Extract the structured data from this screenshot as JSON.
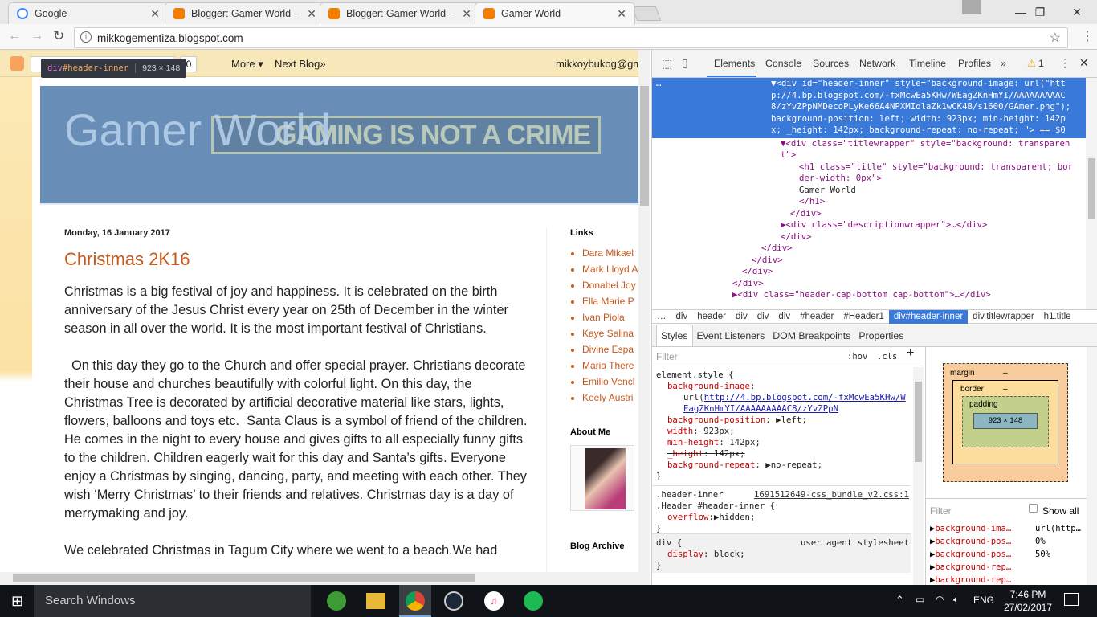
{
  "browser": {
    "tabs": [
      {
        "title": "Google",
        "favicon_color": "#4285f4"
      },
      {
        "title": "Blogger: Gamer World - ",
        "favicon_color": "#f57d00"
      },
      {
        "title": "Blogger: Gamer World - ",
        "favicon_color": "#f57d00"
      },
      {
        "title": "Gamer World",
        "favicon_color": "#f57d00"
      }
    ],
    "url": "mikkogementiza.blogspot.com"
  },
  "blogger_nav": {
    "more": "More ▾",
    "next_blog": "Next Blog»",
    "user": "mikkoybukog@gmail.com",
    "count": "0"
  },
  "tooltip": {
    "selector_tag": "div",
    "selector_id": "#header-inner",
    "size": "923 × 148"
  },
  "blog": {
    "title": "Gamer World",
    "banner_text": "GAMING IS NOT A CRIME",
    "post_date": "Monday, 16 January 2017",
    "post_title": "Christmas 2K16",
    "paragraphs": [
      "Christmas is a big festival of joy and happiness. It is celebrated on the birth anniversary of the Jesus Christ every year on 25th of December in the winter season in all over the world. It is the most important festival of Christians.",
      "  On this day they go to the Church and offer special prayer. Christians decorate their house and churches beautifully with colorful light. On this day, the Christmas Tree is decorated by artificial decorative material like stars, lights, flowers, balloons and toys etc.  Santa Claus is a symbol of friend of the children. He comes in the night to every house and gives gifts to all especially funny gifts to the children. Children eagerly wait for this day and Santa’s gifts. Everyone enjoy a Christmas by singing, dancing, party, and meeting with each other. They wish ‘Merry Christmas’ to their friends and relatives. Christmas day is a day of merrymaking and joy.",
      "We celebrated Christmas in Tagum City where we went to a beach.We had"
    ],
    "sidebar": {
      "links_title": "Links",
      "links": [
        "Dara Mikael",
        "Mark Lloyd A",
        "Donabel Joy",
        "Ella Marie P",
        "Ivan Piola",
        "Kaye Salina",
        "Divine Espa",
        "Maria There",
        "Emilio Vencl",
        "Keely Austri"
      ],
      "about_title": "About Me",
      "archive_title": "Blog Archive"
    }
  },
  "devtools": {
    "tabs": [
      "Elements",
      "Console",
      "Sources",
      "Network",
      "Timeline",
      "Profiles",
      "»"
    ],
    "warnings": "1",
    "dom_lines": [
      {
        "t": "sel",
        "text": "▼<div id=\"header-inner\" style=\"background-image: url(\"http://4.bp.blogspot.com/-fxMcwEa5KHw/WEagZKnHmYI/AAAAAAAAAC8/zYvZPpNMDecoPLyKe66A4NPXMIolaZk1wCK4B/s1600/GAmer.png\"); background-position: left; width: 923px; min-height: 142px; _height: 142px; background-repeat: no-repeat; \"> == $0"
      },
      {
        "t": "l1",
        "text": "▼<div class=\"titlewrapper\" style=\"background: transparent\">"
      },
      {
        "t": "l2",
        "text": "<h1 class=\"title\" style=\"background: transparent; border-width: 0px\">"
      },
      {
        "t": "l3",
        "text": "Gamer World"
      },
      {
        "t": "l2",
        "text": "</h1>"
      },
      {
        "t": "l1b",
        "text": "</div>"
      },
      {
        "t": "l1",
        "text": "▶<div class=\"descriptionwrapper\">…</div>"
      },
      {
        "t": "l0",
        "text": "</div>"
      },
      {
        "t": "m1",
        "text": "</div>"
      },
      {
        "t": "m2",
        "text": "</div>"
      },
      {
        "t": "m3",
        "text": "</div>"
      },
      {
        "t": "m4",
        "text": "</div>"
      },
      {
        "t": "m5",
        "text": "▶<div class=\"header-cap-bottom cap-bottom\">…</div>"
      }
    ],
    "breadcrumb": [
      "…",
      "div",
      "header",
      "div",
      "div",
      "div",
      "#header",
      "#Header1",
      "div#header-inner",
      "div.titlewrapper",
      "h1.title"
    ],
    "subtabs": [
      "Styles",
      "Event Listeners",
      "DOM Breakpoints",
      "Properties"
    ],
    "filter_placeholder": "Filter",
    "hov": ":hov",
    "cls": ".cls",
    "box_model": {
      "margin": "margin",
      "border": "border",
      "padding": "padding",
      "content": "923 × 148",
      "dash": "–"
    },
    "show_all": "Show all",
    "computed": [
      {
        "p": "background-ima…",
        "v": "url(http…"
      },
      {
        "p": "background-pos…",
        "v": "0%"
      },
      {
        "p": "background-pos…",
        "v": "50%"
      },
      {
        "p": "background-rep…",
        "v": ""
      },
      {
        "p": "background-rep…",
        "v": ""
      }
    ],
    "rules": {
      "element_style": "element.style {",
      "bg_image_url": "http://4.bp.blogspot.com/-fxMcwEa5KHw/WEagZKnHmYI/AAAAAAAAAC8/zYvZPpN",
      "decls": [
        "left;",
        "923px;",
        "142px;",
        "142px;",
        "no-repeat;"
      ],
      "src": "1691512649-css_bundle_v2.css:1",
      "sel2a": ".header-inner",
      "sel2b": ".Header #header-inner {",
      "overflow": "hidden;",
      "ua": "user agent stylesheet",
      "div": "div {",
      "display": "block;"
    }
  },
  "taskbar": {
    "search": "Search Windows",
    "lang": "ENG",
    "time": "7:46 PM",
    "date": "27/02/2017"
  }
}
